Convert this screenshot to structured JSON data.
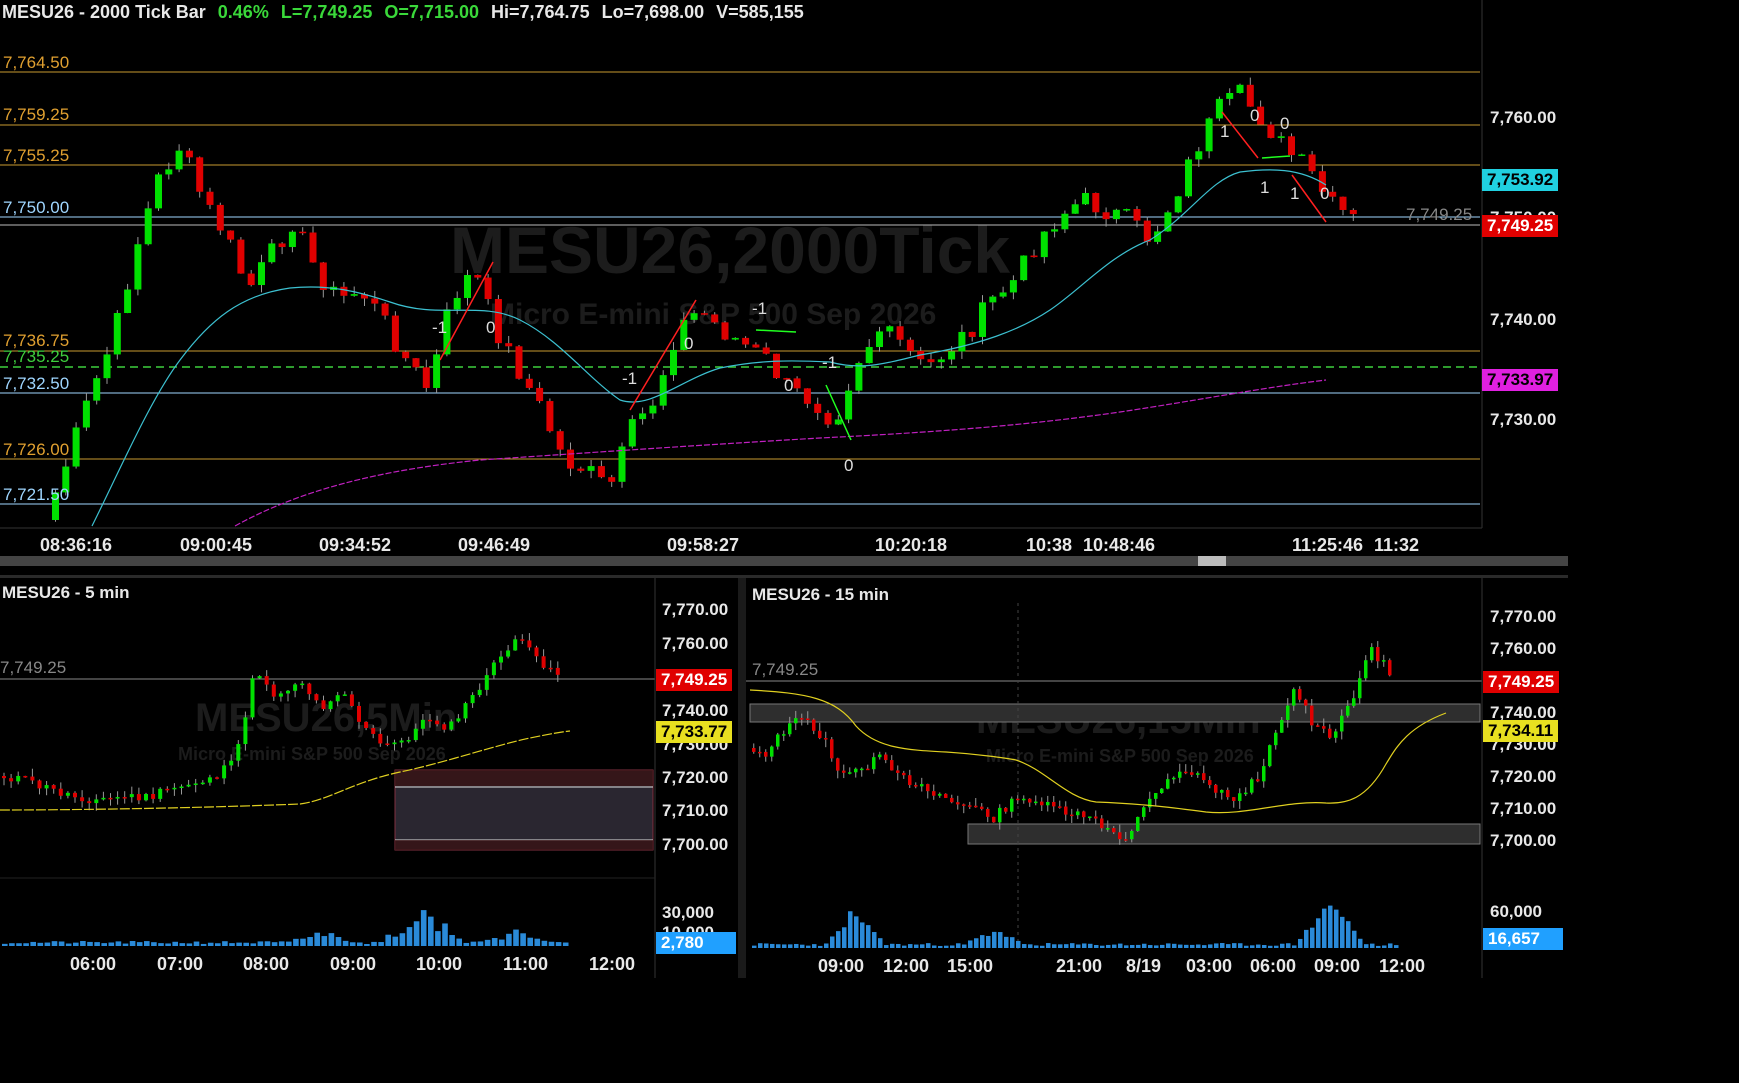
{
  "main": {
    "header": {
      "title": "MESU26 - 2000 Tick Bar",
      "pct": "0.46%",
      "last": "L=7,749.25",
      "open": "O=7,715.00",
      "high": "Hi=7,764.75",
      "low": "Lo=7,698.00",
      "volume": "V=585,155"
    },
    "watermark": "MESU26,2000Tick",
    "watermark_sub": "Micro E-mini S&P 500 Sep 2026",
    "levels": [
      {
        "label": "7,764.50",
        "color": "#e0a030"
      },
      {
        "label": "7,759.25",
        "color": "#e0a030"
      },
      {
        "label": "7,755.25",
        "color": "#e0a030"
      },
      {
        "label": "7,750.00",
        "color": "#9fd6ff"
      },
      {
        "label": "7,736.75",
        "color": "#e0a030"
      },
      {
        "label": "7,735.25",
        "color": "#3ecf3e"
      },
      {
        "label": "7,732.50",
        "color": "#9fd6ff"
      },
      {
        "label": "7,726.00",
        "color": "#e0a030"
      },
      {
        "label": "7,721.50",
        "color": "#9fd6ff"
      }
    ],
    "y_ticks": [
      "7,760.00",
      "7,750.00",
      "7,740.00",
      "7,730.00"
    ],
    "price_tags": {
      "ema_fast": "7,753.92",
      "last": "7,749.25",
      "ema_slow": "7,733.97"
    },
    "last_line_label": "7,749.25",
    "x_ticks": [
      "08:36:16",
      "09:00:45",
      "09:34:52",
      "09:46:49",
      "09:58:27",
      "10:20:18",
      "10:38",
      "10:48:46",
      "11:25:46",
      "11:32"
    ],
    "annotations": [
      "-1",
      "0",
      "0",
      "-1",
      "-1",
      "0",
      "-1",
      "0",
      "0",
      "0",
      "1",
      "0",
      "1",
      "1",
      "0"
    ]
  },
  "five_min": {
    "title": "MESU26 - 5 min",
    "watermark": "MESU26,5Min",
    "watermark_sub": "Micro E-mini S&P 500 Sep 2026",
    "last_line_label": "7,749.25",
    "y_ticks": [
      "7,770.00",
      "7,760.00",
      "7,740.00",
      "7,730.00",
      "7,720.00",
      "7,710.00",
      "7,700.00"
    ],
    "vol_ticks": [
      "30,000",
      "10,000"
    ],
    "price_tags": {
      "last": "7,749.25",
      "ma": "7,733.77",
      "volume": "2,780"
    },
    "x_ticks": [
      "06:00",
      "07:00",
      "08:00",
      "09:00",
      "10:00",
      "11:00",
      "12:00"
    ]
  },
  "fifteen_min": {
    "title": "MESU26 - 15 min",
    "watermark": "MESU26,15Min",
    "watermark_sub": "Micro E-mini S&P 500 Sep 2026",
    "last_line_label": "7,749.25",
    "y_ticks": [
      "7,770.00",
      "7,760.00",
      "7,740.00",
      "7,730.00",
      "7,720.00",
      "7,710.00",
      "7,700.00"
    ],
    "vol_ticks": [
      "60,000"
    ],
    "price_tags": {
      "last": "7,749.25",
      "ma": "7,734.11",
      "volume": "16,657"
    },
    "x_ticks": [
      "09:00",
      "12:00",
      "15:00",
      "21:00",
      "8/19",
      "03:00",
      "06:00",
      "09:00",
      "12:00"
    ]
  },
  "colors": {
    "up": "#00e000",
    "down": "#e00000",
    "fast_ma": "#3cc0d0",
    "slow_ma": "#c020c0",
    "yellow_ma": "#e0d020",
    "last_tag": "#e00000",
    "fast_tag": "#20d0e0",
    "slow_tag": "#e020e0",
    "ma_tag": "#e8e020",
    "vol_tag": "#20a0ff"
  }
}
